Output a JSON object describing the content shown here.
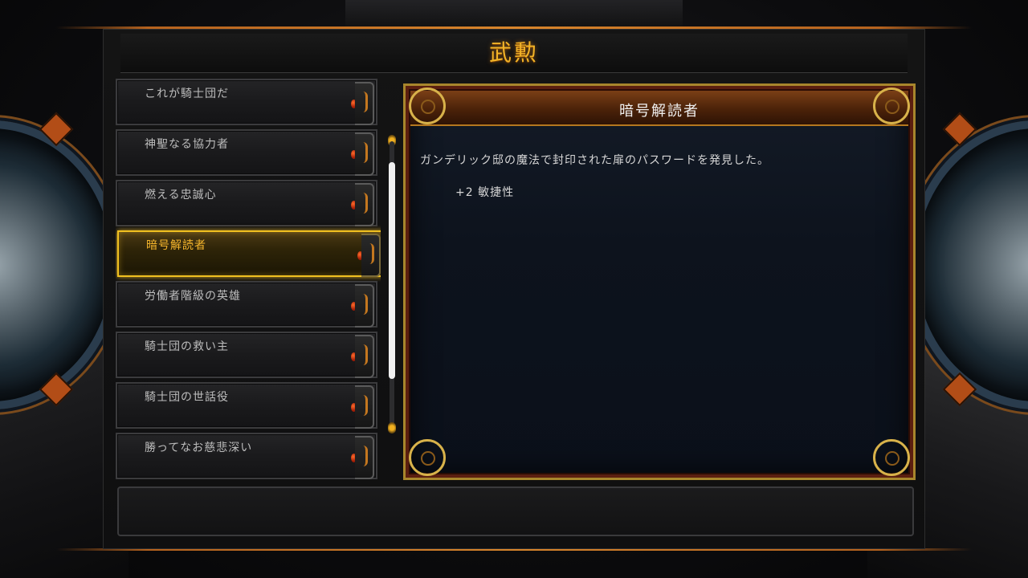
{
  "page": {
    "title": "武勲"
  },
  "deeds": [
    {
      "label": "これが騎士団だ"
    },
    {
      "label": "神聖なる協力者"
    },
    {
      "label": "燃える忠誠心"
    },
    {
      "label": "暗号解読者"
    },
    {
      "label": "労働者階級の英雄"
    },
    {
      "label": "騎士団の救い主"
    },
    {
      "label": "騎士団の世話役"
    },
    {
      "label": "勝ってなお慈悲深い"
    }
  ],
  "selected_index": 3,
  "detail": {
    "title": "暗号解読者",
    "description": "ガンデリック邸の魔法で封印された扉のパスワードを発見した。",
    "bonus": "+2 敏捷性"
  },
  "scroll": {
    "position": 0.3
  },
  "colors": {
    "accent": "#f2b428",
    "frame_gold": "#a8862c",
    "frame_red": "#5b1f10"
  },
  "icons": [
    "gem-icon",
    "bracket-icon",
    "scroll-cap-icon",
    "corner-ornament-icon",
    "lion-emblem-icon"
  ]
}
